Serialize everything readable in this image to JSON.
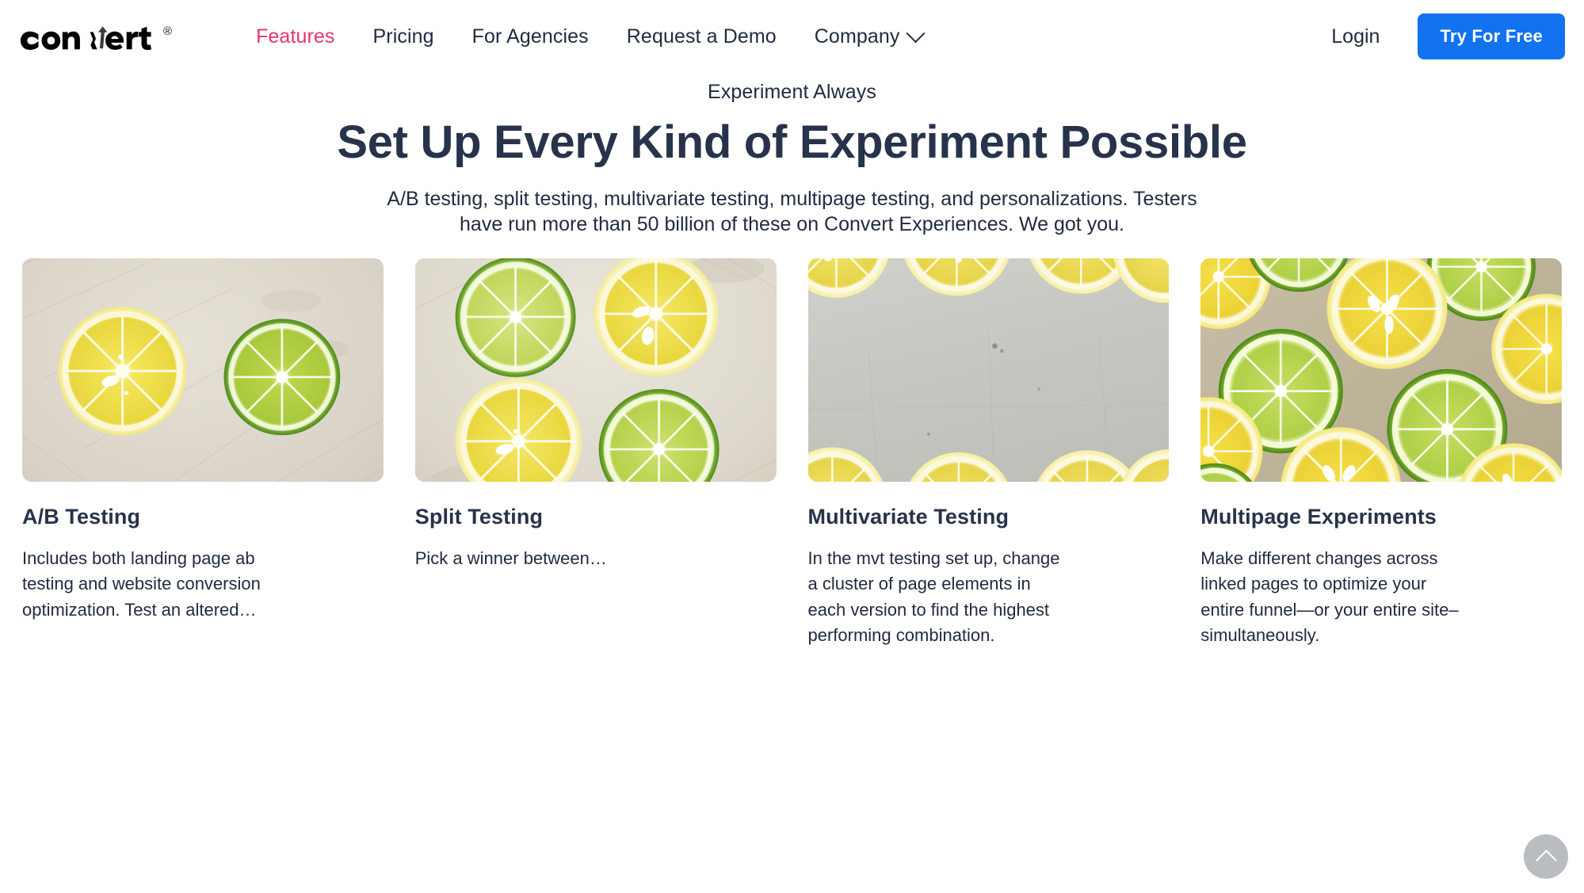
{
  "header": {
    "logo": {
      "name": "convert",
      "wordmark_part1": "con",
      "wordmark_part2": "ert",
      "registered_mark": "®"
    },
    "nav": [
      {
        "label": "Features",
        "active": true,
        "has_dropdown": false
      },
      {
        "label": "Pricing",
        "active": false,
        "has_dropdown": false
      },
      {
        "label": "For Agencies",
        "active": false,
        "has_dropdown": false
      },
      {
        "label": "Request a Demo",
        "active": false,
        "has_dropdown": false
      },
      {
        "label": "Company",
        "active": false,
        "has_dropdown": true
      }
    ],
    "login_label": "Login",
    "cta_label": "Try For Free",
    "colors": {
      "active_nav": "#E5356B",
      "nav_text": "#212B41",
      "cta_background": "#1272F0",
      "cta_text": "#FFFFFF"
    }
  },
  "hero": {
    "eyebrow": "Experiment Always",
    "title": "Set Up Every Kind of Experiment Possible",
    "subtitle": "A/B testing, split testing, multivariate testing, multipage testing, and personalizations. Testers have run more than 50 billion of these on Convert Experiences. We got you."
  },
  "cards": [
    {
      "title": "A/B Testing",
      "description": "Includes both landing page ab testing and website conversion optimization. Test an altered…",
      "image_alt": "lemon-and-lime-halves-on-concrete"
    },
    {
      "title": "Split Testing",
      "description": "Pick a winner between…",
      "image_alt": "four-citrus-slices-grid-on-concrete"
    },
    {
      "title": "Multivariate Testing",
      "description": "In the mvt testing set up, change a cluster of page elements in each version to find the highest performing combination.",
      "image_alt": "lemon-slices-framing-concrete-background"
    },
    {
      "title": "Multipage Experiments",
      "description": "Make different changes across linked pages to optimize your entire funnel—or your entire site–simultaneously.",
      "image_alt": "mosaic-of-lemon-and-lime-slices"
    }
  ],
  "scroll_top": {
    "label": "Back to top",
    "icon": "chevron-up-icon",
    "background": "#B9BDC1"
  }
}
